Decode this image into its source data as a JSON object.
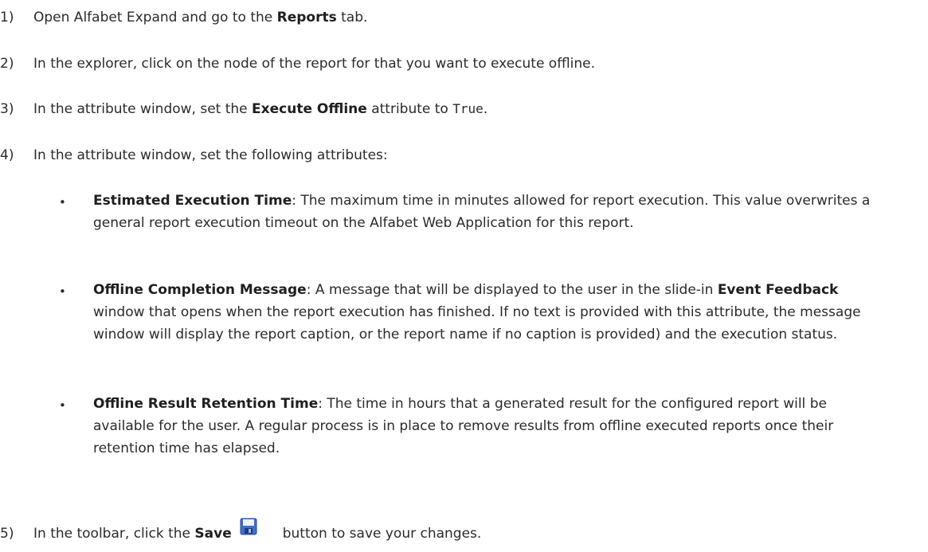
{
  "steps": [
    {
      "num": "1)",
      "pre": "Open Alfabet Expand and go to the ",
      "bold": "Reports",
      "post": " tab."
    },
    {
      "num": "2)",
      "text": "In the explorer, click on the node of the report for that you want to execute offline."
    },
    {
      "num": "3)",
      "pre": "In the attribute window, set the ",
      "bold": "Execute Offline",
      "mid": " attribute to ",
      "code": "True",
      "post": "."
    },
    {
      "num": "4)",
      "text": "In the attribute window, set the following attributes:"
    },
    {
      "num": "5)",
      "pre": "In the toolbar, click the ",
      "bold": "Save",
      "post": "button to save your changes."
    }
  ],
  "bullets": [
    {
      "bold": "Estimated Execution Time",
      "text": ": The maximum time in minutes allowed for report execution. This value overwrites a general report execution timeout on the Alfabet Web Application for this report."
    },
    {
      "bold": "Offline Completion Message",
      "text1": ": A message that will be displayed to the user in the slide-in ",
      "bold2": "Event Feedback",
      "text2": " window that opens when the report execution has finished. If no text is provided with this attribute, the message window will display the report caption, or the report name if no caption is provided) and the execution status."
    },
    {
      "bold": "Offline Result Retention Time",
      "text": ": The time in hours that a generated result for the configured report will be available for the user. A regular process is in place to remove results from offline executed reports once their retention time has elapsed."
    }
  ],
  "bullet_char": "•",
  "icons": {
    "save": "floppy-disk-save-icon"
  }
}
